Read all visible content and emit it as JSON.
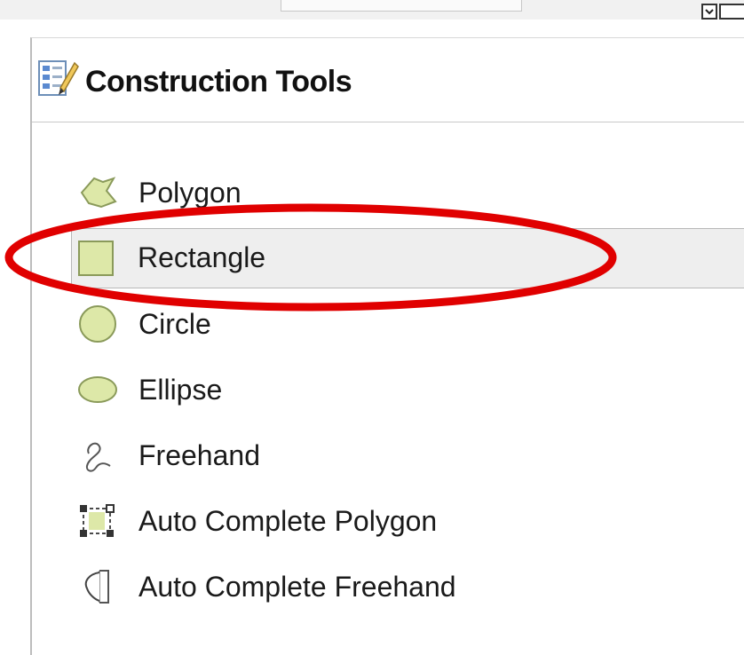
{
  "panel": {
    "title": "Construction Tools",
    "header_icon": "construction-tools-icon"
  },
  "tools": [
    {
      "label": "Polygon",
      "icon": "polygon-icon",
      "selected": false
    },
    {
      "label": "Rectangle",
      "icon": "rectangle-icon",
      "selected": true
    },
    {
      "label": "Circle",
      "icon": "circle-icon",
      "selected": false
    },
    {
      "label": "Ellipse",
      "icon": "ellipse-icon",
      "selected": false
    },
    {
      "label": "Freehand",
      "icon": "freehand-icon",
      "selected": false
    },
    {
      "label": "Auto Complete Polygon",
      "icon": "auto-complete-polygon-icon",
      "selected": false
    },
    {
      "label": "Auto Complete Freehand",
      "icon": "auto-complete-freehand-icon",
      "selected": false
    }
  ],
  "colors": {
    "shape_fill": "#dde8a8",
    "shape_stroke": "#8a9a5a",
    "annotation": "#e00000",
    "selected_bg": "#eeeeee"
  }
}
